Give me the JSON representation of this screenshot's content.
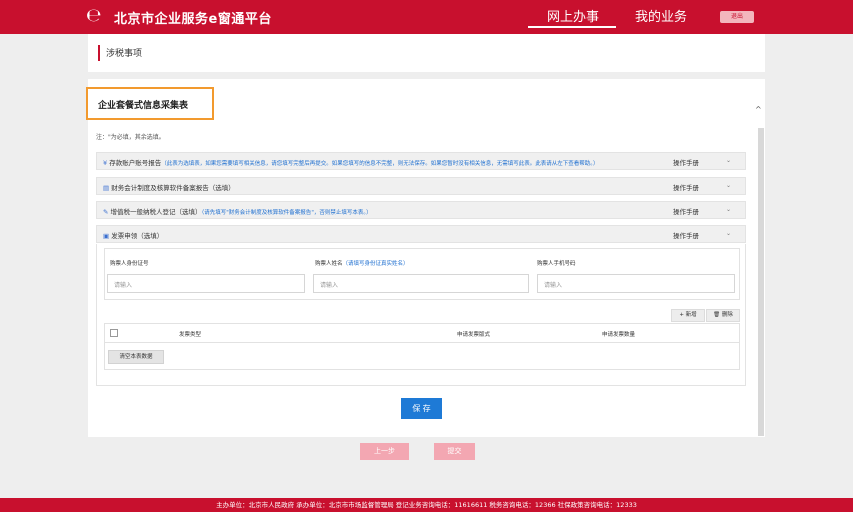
{
  "header": {
    "logo_glyph": "℮",
    "title": "北京市企业服务e窗通平台",
    "nav": [
      "网上办事",
      "我的业务"
    ],
    "active_nav": "网上办事",
    "logout_label": "退出"
  },
  "breadcrumb": "涉税事项",
  "form": {
    "title": "企业套餐式信息采集表",
    "note": "注：\"为必填，其余选填。",
    "sections": [
      {
        "icon": "¥",
        "title": "存款账户账号报告",
        "hint": "（此表为选填表，如果您需要填写相关信息，请您填写完整后再提交。如果您填写的信息不完整，则无法保存。如果您暂时没有相关信息，无需填写此表。此表请从左下查看帮助。）",
        "manual_label": "操作手册"
      },
      {
        "icon": "▤",
        "title": "财务会计制度及核算软件备案报告（选填）",
        "hint": "",
        "manual_label": "操作手册"
      },
      {
        "icon": "✎",
        "title": "增值税一般纳税人登记（选填）",
        "hint": "（请先填写\"财务会计制度及核算软件备案报告\"，否则禁止填写本表。）",
        "manual_label": "操作手册"
      },
      {
        "icon": "▣",
        "title": "发票申领（选填）",
        "hint": "",
        "manual_label": "操作手册"
      }
    ],
    "invoice": {
      "fields": [
        {
          "label": "购票人身份证号",
          "hint": "",
          "placeholder": "请输入"
        },
        {
          "label": "购票人姓名",
          "hint": "（请填写身份证真实姓名）",
          "placeholder": "请输入"
        },
        {
          "label": "购票人手机号码",
          "hint": "",
          "placeholder": "请输入"
        }
      ],
      "add_label": "+ 新增",
      "delete_label": "🗑 删除",
      "columns": [
        "发票类型",
        "申请发票版式",
        "申请发票数量"
      ],
      "clear_label": "清空本表数据"
    },
    "save_label": "保 存"
  },
  "bottom_buttons": {
    "prev_label": "上一步",
    "submit_label": "提交"
  },
  "footer_text": "主办单位：北京市人民政府  承办单位：北京市市场监督管理局  登记业务咨询电话：11616611  税务咨询电话：12366  社保政策咨询电话：12333"
}
